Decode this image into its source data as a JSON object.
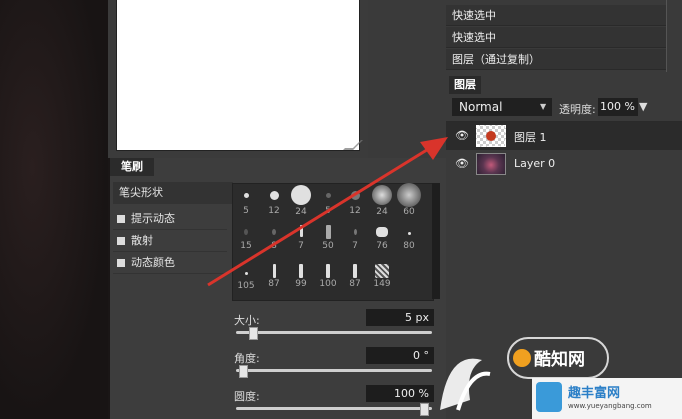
{
  "history": [
    "快速选中",
    "快速选中",
    "图层（通过复制）"
  ],
  "layers_panel": {
    "tab": "图层",
    "blend_mode": "Normal",
    "opacity_label": "透明度:",
    "opacity_value": "100 %",
    "layers": [
      {
        "name": "图层 1",
        "selected": true,
        "visible_icon": "eye-icon"
      },
      {
        "name": "Layer 0",
        "selected": false,
        "visible_icon": "eye-icon"
      }
    ]
  },
  "brush_panel": {
    "tab": "笔刷",
    "sections": [
      {
        "label": "笔尖形状",
        "checkbox": false
      },
      {
        "label": "提示动态",
        "checkbox": true
      },
      {
        "label": "散射",
        "checkbox": true
      },
      {
        "label": "动态颜色",
        "checkbox": true
      }
    ],
    "presets": [
      "5",
      "12",
      "24",
      "5",
      "12",
      "24",
      "60",
      "15",
      "8",
      "7",
      "50",
      "7",
      "76",
      "80",
      "105",
      "87",
      "99",
      "100",
      "87",
      "149"
    ],
    "size_label": "大小:",
    "size_value": "5 px",
    "angle_label": "角度:",
    "angle_value": "0 °",
    "roundness_label": "圆度:",
    "roundness_value": "100 %"
  },
  "watermark": {
    "logo_text": "酷知网",
    "site_text": "趣丰富网",
    "site_url": "www.yueyangbang.com"
  },
  "colors": {
    "arrow": "#d9342b",
    "panel": "#3a3a3a",
    "dark": "#1d1d1d"
  }
}
